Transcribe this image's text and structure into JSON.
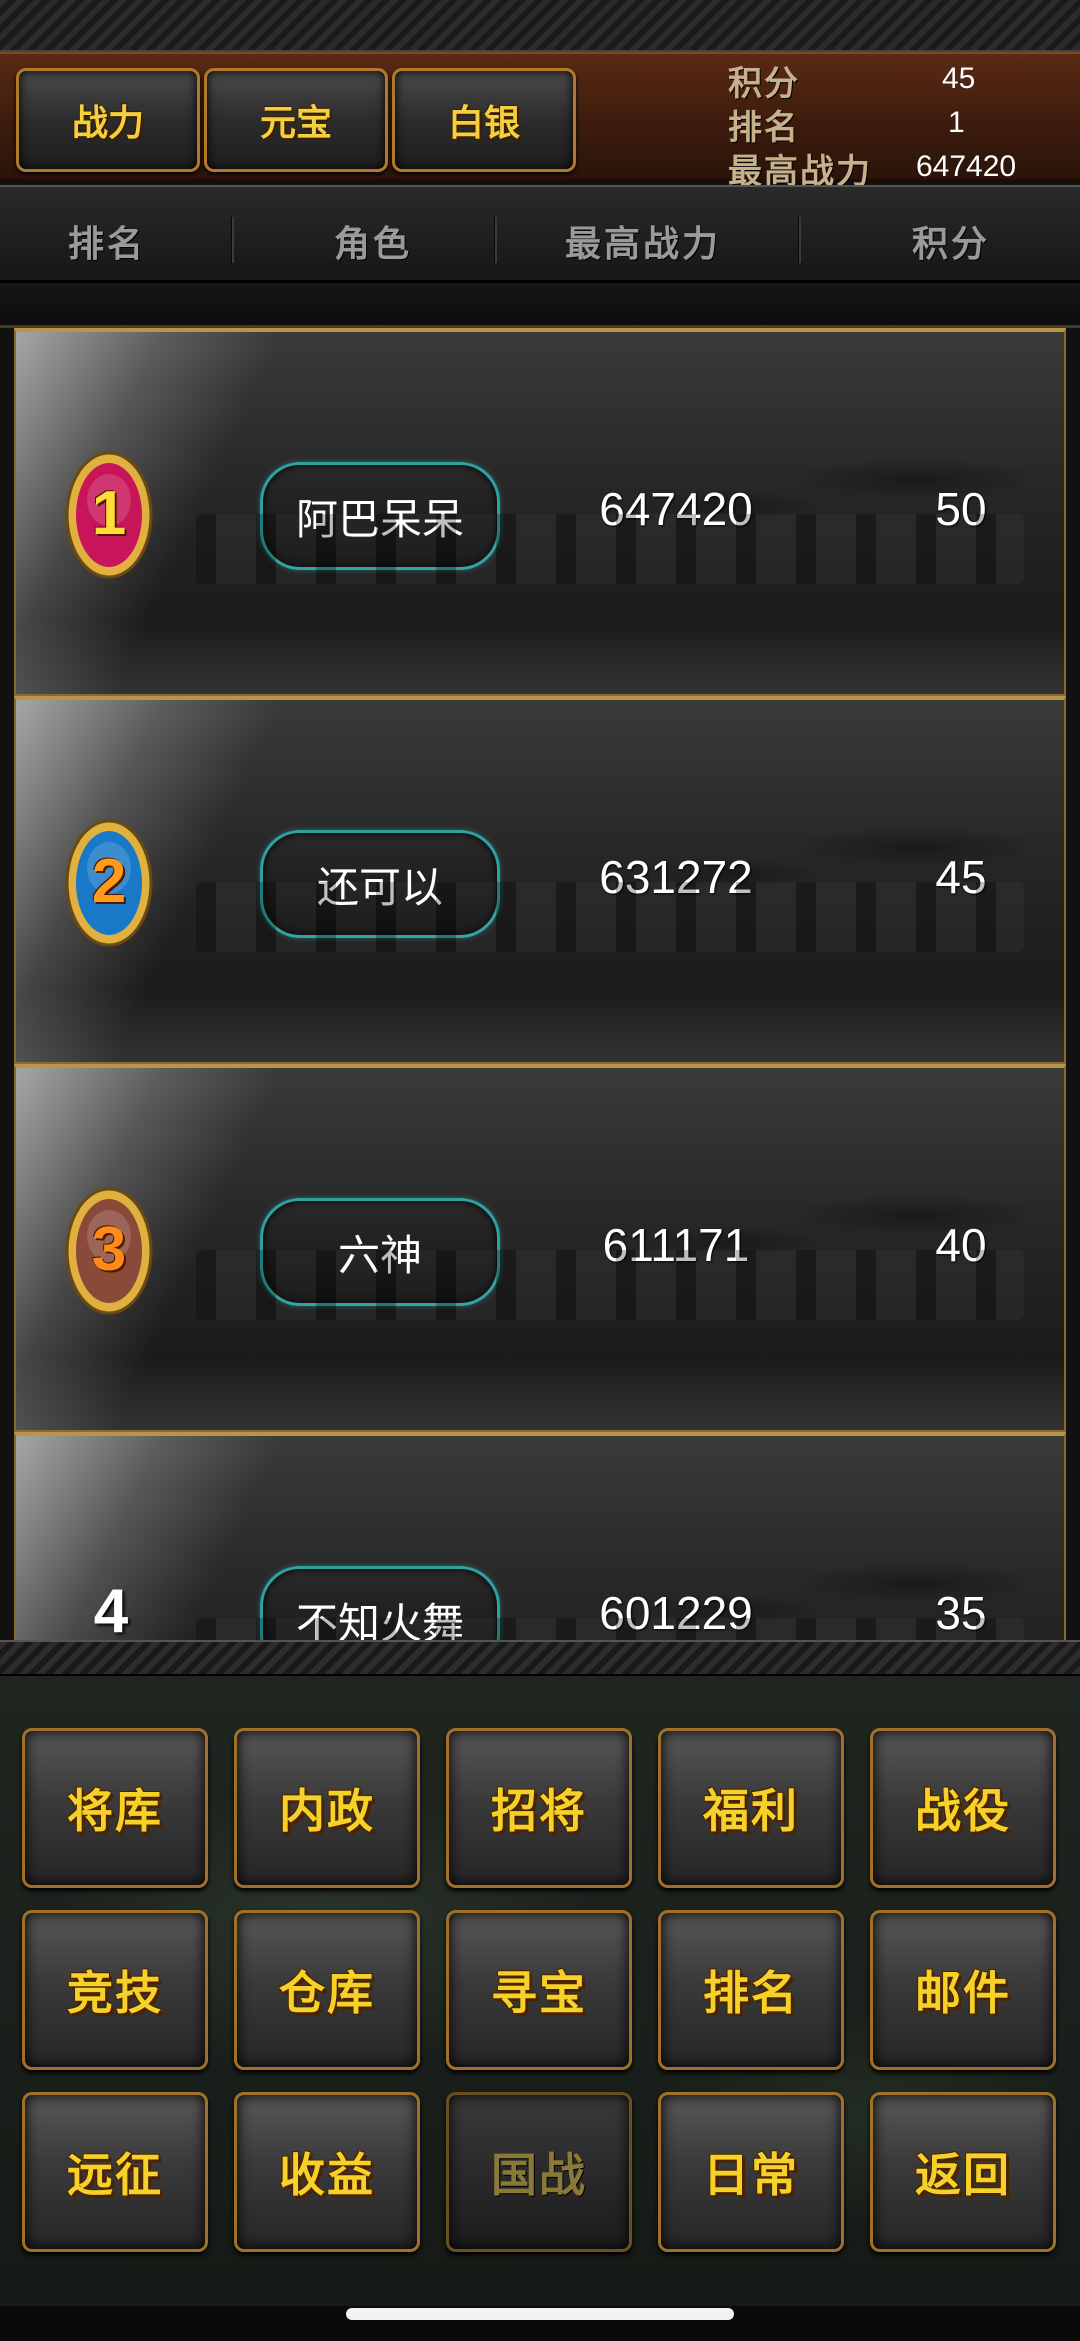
{
  "tabs": [
    {
      "label": "战力"
    },
    {
      "label": "元宝"
    },
    {
      "label": "白银"
    }
  ],
  "my_stats": [
    {
      "label": "积分",
      "value": "45"
    },
    {
      "label": "排名",
      "value": "1"
    },
    {
      "label": "最高战力",
      "value": "647420"
    }
  ],
  "columns": {
    "rank": "排名",
    "role": "角色",
    "max_power": "最高战力",
    "score": "积分"
  },
  "rows": [
    {
      "rank": "1",
      "name": "阿巴呆呆",
      "power": "647420",
      "score": "50",
      "medal_color": "#c8155a"
    },
    {
      "rank": "2",
      "name": "还可以",
      "power": "631272",
      "score": "45",
      "medal_color": "#1a78c8"
    },
    {
      "rank": "3",
      "name": "六神",
      "power": "611171",
      "score": "40",
      "medal_color": "#8a4a3a"
    },
    {
      "rank": "4",
      "name": "不知火舞",
      "power": "601229",
      "score": "35"
    }
  ],
  "menu": [
    [
      "将库",
      "内政",
      "招将",
      "福利",
      "战役"
    ],
    [
      "竞技",
      "仓库",
      "寻宝",
      "排名",
      "邮件"
    ],
    [
      "远征",
      "收益",
      "国战",
      "日常",
      "返回"
    ]
  ],
  "colors": {
    "accent_gold": "#f4d03f",
    "header_brown": "#4a2210",
    "pill_border": "#2fa0a0",
    "frame_gold": "#b89548"
  }
}
